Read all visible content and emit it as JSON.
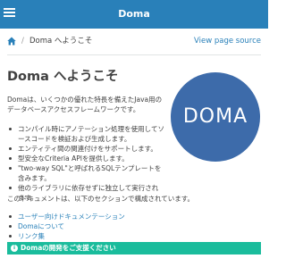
{
  "header": {
    "title": "Doma",
    "menu_icon": "hamburger-menu-icon"
  },
  "breadcrumb": {
    "home_icon": "home-icon",
    "separator": "/",
    "current": "Doma へようこそ"
  },
  "source_link": "View page source",
  "page": {
    "title": "Doma へようこそ",
    "logo_text": "DOMA",
    "intro": "Domaは、いくつかの優れた特長を備えたJava用のデータベースアクセスフレームワークです。",
    "features": [
      "コンパイル時にアノテーション処理を使用してソースコードを検証および生成します。",
      "エンティティ間の関連付けをサポートします。",
      "型安全なCriteria APIを提供します。",
      "\"two-way SQL\"と呼ばれるSQLテンプレートを含みます。",
      "他のライブラリに依存せずに独立して実行されます。"
    ],
    "sections_intro": "このドキュメントは、以下のセクションで構成されています。",
    "section_links": [
      "ユーザー向けドキュメンテーション",
      "Domaについて",
      "リンク集"
    ],
    "support_banner": "Domaの開発をご支援ください"
  },
  "colors": {
    "header_bg": "#2980b9",
    "link": "#2980b9",
    "logo_bg": "#3d6baa",
    "support_bg": "#1abc9c"
  }
}
